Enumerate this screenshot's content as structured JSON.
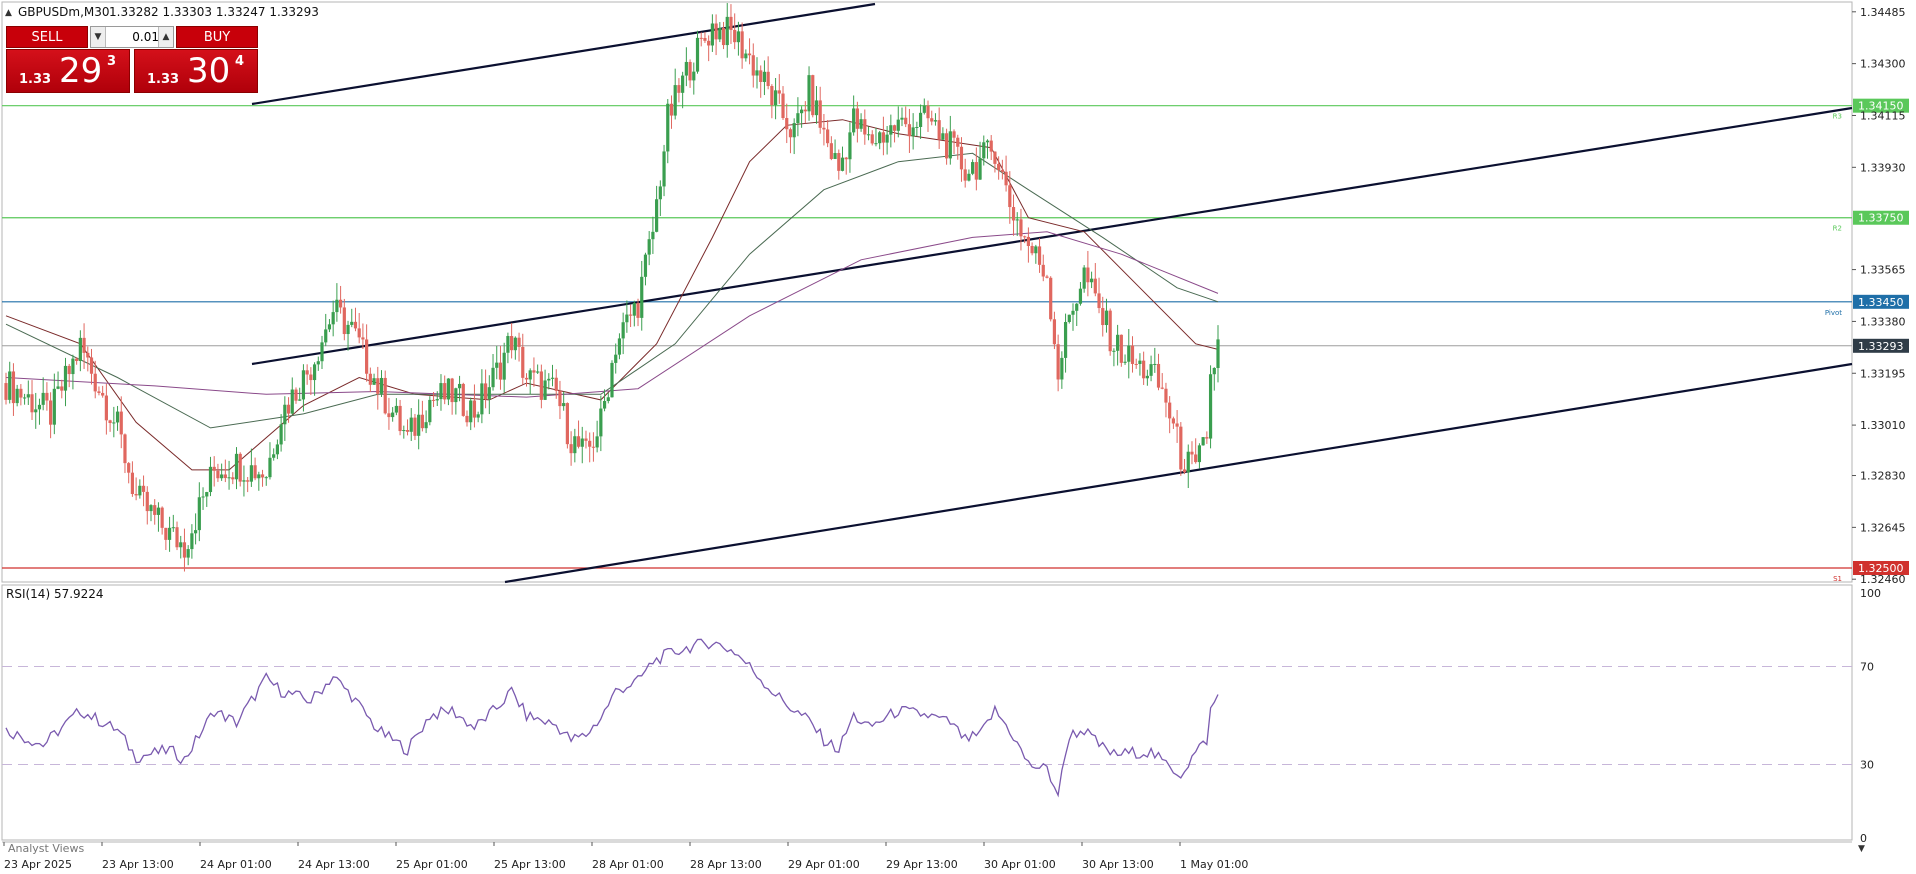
{
  "header": {
    "symbol": "GBPUSDm,M30",
    "ohlc": "1.33282 1.33303 1.33247 1.33293"
  },
  "trade_panel": {
    "sell_label": "SELL",
    "buy_label": "BUY",
    "lot_value": "0.01",
    "sell_price": {
      "main": "1.33",
      "big": "29",
      "sup": "3"
    },
    "buy_price": {
      "main": "1.33",
      "big": "30",
      "sup": "4"
    }
  },
  "indicator": {
    "rsi_label": "RSI(14) 57.9224",
    "levels": [
      "100",
      "70",
      "30",
      "0"
    ]
  },
  "footer": {
    "analyst_views": "Analyst Views"
  },
  "colors": {
    "bull": "#3a9e4f",
    "bear": "#e0675f",
    "pivot_line": "#1f6fa8",
    "support_line": "#d0312d",
    "resistance_line": "#5ac85a",
    "rsi_line": "#7a5aaf"
  },
  "chart_data": [
    {
      "type": "candlestick",
      "title": "GBPUSDm,M30",
      "y_ticks": [
        "1.34485",
        "1.34300",
        "1.34115",
        "1.33930",
        "1.33565",
        "1.33380",
        "1.33195",
        "1.33010",
        "1.32830",
        "1.32645",
        "1.32460"
      ],
      "x_ticks": [
        "23 Apr 2025",
        "23 Apr 13:00",
        "24 Apr 01:00",
        "24 Apr 13:00",
        "25 Apr 01:00",
        "25 Apr 13:00",
        "28 Apr 01:00",
        "28 Apr 13:00",
        "29 Apr 01:00",
        "29 Apr 13:00",
        "30 Apr 01:00",
        "30 Apr 13:00",
        "1 May 01:00"
      ],
      "ylim": [
        1.3245,
        1.3452
      ],
      "current_price": "1.33293",
      "horizontal_levels": [
        {
          "tag": "R3",
          "price": "1.34150",
          "color": "#5ac85a"
        },
        {
          "tag": "R2",
          "price": "1.33750",
          "color": "#5ac85a"
        },
        {
          "tag": "Pivot",
          "price": "1.33450",
          "color": "#1f6fa8"
        },
        {
          "tag": "S1",
          "price": "1.32500",
          "color": "#d0312d"
        }
      ],
      "close_path": [
        [
          0,
          1.3316
        ],
        [
          12,
          1.3305
        ],
        [
          20,
          1.3329
        ],
        [
          30,
          1.33
        ],
        [
          35,
          1.3275
        ],
        [
          44,
          1.3262
        ],
        [
          48,
          1.3258
        ],
        [
          56,
          1.3285
        ],
        [
          62,
          1.3287
        ],
        [
          70,
          1.3284
        ],
        [
          74,
          1.3305
        ],
        [
          82,
          1.3322
        ],
        [
          88,
          1.3342
        ],
        [
          93,
          1.3335
        ],
        [
          100,
          1.3315
        ],
        [
          108,
          1.3296
        ],
        [
          114,
          1.331
        ],
        [
          120,
          1.3312
        ],
        [
          126,
          1.3306
        ],
        [
          132,
          1.332
        ],
        [
          136,
          1.3332
        ],
        [
          140,
          1.3318
        ],
        [
          148,
          1.3312
        ],
        [
          152,
          1.3296
        ],
        [
          156,
          1.329
        ],
        [
          160,
          1.3302
        ],
        [
          164,
          1.333
        ],
        [
          170,
          1.3345
        ],
        [
          174,
          1.337
        ],
        [
          178,
          1.341
        ],
        [
          184,
          1.343
        ],
        [
          190,
          1.3443
        ],
        [
          196,
          1.344
        ],
        [
          200,
          1.3432
        ],
        [
          206,
          1.3418
        ],
        [
          212,
          1.3405
        ],
        [
          216,
          1.342
        ],
        [
          220,
          1.3405
        ],
        [
          224,
          1.3392
        ],
        [
          228,
          1.341
        ],
        [
          232,
          1.3402
        ],
        [
          240,
          1.3408
        ],
        [
          248,
          1.341
        ],
        [
          254,
          1.34
        ],
        [
          258,
          1.3392
        ],
        [
          262,
          1.3395
        ],
        [
          266,
          1.34
        ],
        [
          270,
          1.338
        ],
        [
          275,
          1.3365
        ],
        [
          280,
          1.3355
        ],
        [
          283,
          1.332
        ],
        [
          286,
          1.334
        ],
        [
          290,
          1.3355
        ],
        [
          294,
          1.3342
        ],
        [
          298,
          1.333
        ],
        [
          304,
          1.3322
        ],
        [
          308,
          1.332
        ],
        [
          312,
          1.331
        ],
        [
          316,
          1.329
        ],
        [
          320,
          1.3284
        ],
        [
          323,
          1.3298
        ],
        [
          324,
          1.3318
        ],
        [
          326,
          1.3329
        ]
      ],
      "ma_fast": [
        [
          0,
          1.334
        ],
        [
          20,
          1.333
        ],
        [
          35,
          1.3302
        ],
        [
          50,
          1.3285
        ],
        [
          60,
          1.3285
        ],
        [
          80,
          1.3308
        ],
        [
          95,
          1.3318
        ],
        [
          110,
          1.3312
        ],
        [
          130,
          1.331
        ],
        [
          140,
          1.3316
        ],
        [
          160,
          1.331
        ],
        [
          175,
          1.333
        ],
        [
          190,
          1.3368
        ],
        [
          200,
          1.3395
        ],
        [
          210,
          1.3408
        ],
        [
          225,
          1.341
        ],
        [
          240,
          1.3405
        ],
        [
          255,
          1.3402
        ],
        [
          265,
          1.34
        ],
        [
          275,
          1.3375
        ],
        [
          290,
          1.337
        ],
        [
          305,
          1.335
        ],
        [
          320,
          1.333
        ],
        [
          326,
          1.3328
        ]
      ],
      "ma_mid": [
        [
          0,
          1.3337
        ],
        [
          30,
          1.3318
        ],
        [
          55,
          1.33
        ],
        [
          80,
          1.3305
        ],
        [
          100,
          1.3312
        ],
        [
          130,
          1.3312
        ],
        [
          160,
          1.3312
        ],
        [
          180,
          1.333
        ],
        [
          200,
          1.3362
        ],
        [
          220,
          1.3385
        ],
        [
          240,
          1.3395
        ],
        [
          260,
          1.3398
        ],
        [
          275,
          1.3385
        ],
        [
          295,
          1.3368
        ],
        [
          315,
          1.335
        ],
        [
          326,
          1.3345
        ]
      ],
      "ma_slow": [
        [
          0,
          1.3318
        ],
        [
          40,
          1.3315
        ],
        [
          70,
          1.3312
        ],
        [
          100,
          1.3313
        ],
        [
          140,
          1.3311
        ],
        [
          170,
          1.3314
        ],
        [
          200,
          1.334
        ],
        [
          230,
          1.336
        ],
        [
          260,
          1.3368
        ],
        [
          280,
          1.337
        ],
        [
          300,
          1.3362
        ],
        [
          326,
          1.3348
        ]
      ]
    },
    {
      "type": "line",
      "title": "RSI(14) 57.9224",
      "ylim": [
        0,
        100
      ],
      "y_ticks": [
        "100",
        "70",
        "30",
        "0"
      ],
      "levels": [
        70,
        30
      ],
      "values": [
        [
          0,
          44
        ],
        [
          10,
          38
        ],
        [
          20,
          52
        ],
        [
          30,
          44
        ],
        [
          35,
          33
        ],
        [
          44,
          36
        ],
        [
          48,
          32
        ],
        [
          56,
          52
        ],
        [
          62,
          47
        ],
        [
          70,
          65
        ],
        [
          74,
          60
        ],
        [
          82,
          56
        ],
        [
          88,
          66
        ],
        [
          93,
          58
        ],
        [
          100,
          44
        ],
        [
          108,
          36
        ],
        [
          114,
          50
        ],
        [
          120,
          52
        ],
        [
          126,
          45
        ],
        [
          132,
          53
        ],
        [
          136,
          60
        ],
        [
          140,
          50
        ],
        [
          148,
          46
        ],
        [
          152,
          40
        ],
        [
          156,
          42
        ],
        [
          160,
          49
        ],
        [
          164,
          60
        ],
        [
          170,
          64
        ],
        [
          174,
          72
        ],
        [
          178,
          75
        ],
        [
          184,
          78
        ],
        [
          190,
          80
        ],
        [
          196,
          76
        ],
        [
          200,
          70
        ],
        [
          206,
          60
        ],
        [
          212,
          52
        ],
        [
          216,
          48
        ],
        [
          220,
          40
        ],
        [
          224,
          36
        ],
        [
          228,
          50
        ],
        [
          232,
          45
        ],
        [
          240,
          52
        ],
        [
          248,
          50
        ],
        [
          254,
          47
        ],
        [
          258,
          40
        ],
        [
          262,
          42
        ],
        [
          266,
          52
        ],
        [
          270,
          44
        ],
        [
          275,
          30
        ],
        [
          280,
          28
        ],
        [
          283,
          18
        ],
        [
          286,
          42
        ],
        [
          290,
          44
        ],
        [
          294,
          38
        ],
        [
          298,
          34
        ],
        [
          304,
          35
        ],
        [
          308,
          35
        ],
        [
          312,
          30
        ],
        [
          316,
          26
        ],
        [
          320,
          35
        ],
        [
          323,
          40
        ],
        [
          324,
          52
        ],
        [
          326,
          58
        ]
      ]
    }
  ]
}
